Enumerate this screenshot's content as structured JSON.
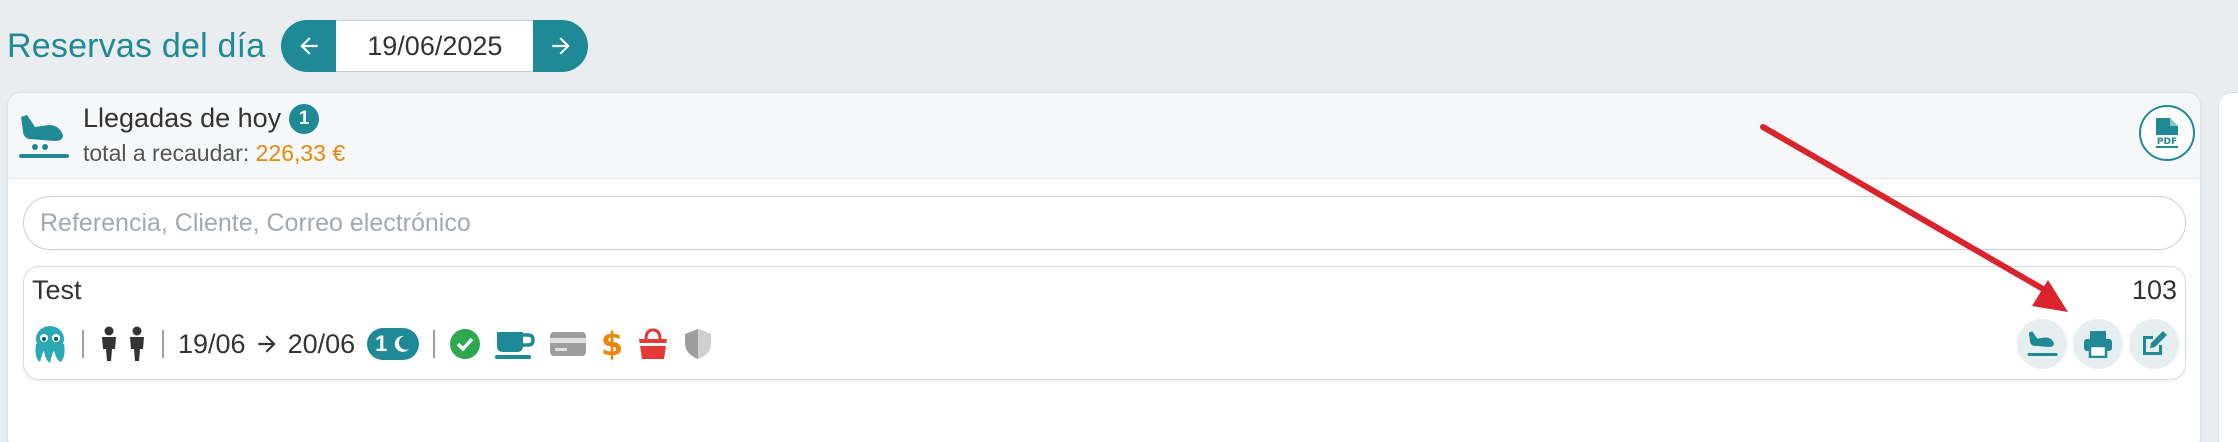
{
  "header": {
    "title": "Reservas del día",
    "date_value": "19/06/2025"
  },
  "arrivals": {
    "title": "Llegadas de hoy",
    "count": "1",
    "total_label": "total a recaudar:",
    "total_amount": "226,33 €",
    "pdf_label": "PDF"
  },
  "search": {
    "placeholder": "Referencia, Cliente, Correo electrónico"
  },
  "booking": {
    "name": "Test",
    "room": "103",
    "date_from": "19/06",
    "date_to": "20/06",
    "nights": "1",
    "icons": [
      "octopus-avatar-icon",
      "person-icon",
      "person-icon",
      "check-circle-icon",
      "coffee-icon",
      "credit-card-icon",
      "dollar-icon",
      "basket-icon",
      "shield-icon"
    ],
    "actions": [
      "arrival-checkin-icon",
      "printer-icon",
      "edit-icon"
    ]
  },
  "colors": {
    "brand": "#1f8a96",
    "amount": "#e8870c",
    "check": "#2ea84f",
    "dollar": "#e8870c",
    "basket": "#e53935",
    "annotation_arrow": "#d9232d"
  }
}
